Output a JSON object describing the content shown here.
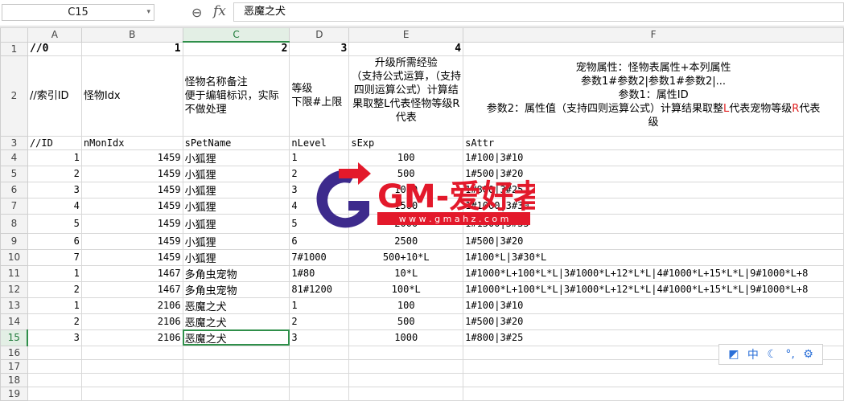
{
  "formula_bar": {
    "name_box": "C15",
    "fx_label": "fx",
    "value": "恶魔之犬"
  },
  "columns": [
    "A",
    "B",
    "C",
    "D",
    "E",
    "F"
  ],
  "row_numbers": [
    "1",
    "2",
    "3",
    "4",
    "5",
    "6",
    "7",
    "8",
    "9",
    "10",
    "11",
    "12",
    "13",
    "14",
    "15",
    "16",
    "17",
    "18",
    "19"
  ],
  "row1": [
    "//0",
    "1",
    "2",
    "3",
    "4",
    ""
  ],
  "row2": {
    "a": "//索引ID",
    "b": "怪物Idx",
    "c": "怪物名称备注\n便于编辑标识，实际不做处理",
    "d": "等级\n下限#上限",
    "e": "升级所需经验\n（支持公式运算，（支持四则运算公式）计算结果取整L代表怪物等级R代表",
    "f_line1": "宠物属性：怪物表属性+本列属性",
    "f_line2": "参数1#参数2|参数1#参数2|...",
    "f_line3": "参数1：属性ID",
    "f_line4a": "参数2：属性值（支持四则运算公式）计算结果取整",
    "f_red1": "L",
    "f_line4b": "代表宠物等级",
    "f_red2": "R",
    "f_line4c": "代表",
    "f_line5": "级"
  },
  "row3": [
    "//ID",
    "nMonIdx",
    "sPetName",
    "nLevel",
    "sExp",
    "sAttr"
  ],
  "data_rows": [
    [
      "1",
      "1459",
      "小狐狸",
      "1",
      "100",
      "1#100|3#10"
    ],
    [
      "2",
      "1459",
      "小狐狸",
      "2",
      "500",
      "1#500|3#20"
    ],
    [
      "3",
      "1459",
      "小狐狸",
      "3",
      "1000",
      "1#800|3#25"
    ],
    [
      "4",
      "1459",
      "小狐狸",
      "4",
      "1500",
      "1#1000|3#30"
    ],
    [
      "5",
      "1459",
      "小狐狸",
      "5",
      "2000",
      "1#1500|3#35"
    ],
    [
      "6",
      "1459",
      "小狐狸",
      "6",
      "2500",
      "1#500|3#20"
    ],
    [
      "7",
      "1459",
      "小狐狸",
      "7#1000",
      "500+10*L",
      "1#100*L|3#30*L"
    ],
    [
      "1",
      "1467",
      "多角虫宠物",
      "1#80",
      "10*L",
      "1#1000*L+100*L*L|3#1000*L+12*L*L|4#1000*L+15*L*L|9#1000*L+8"
    ],
    [
      "2",
      "1467",
      "多角虫宠物",
      "81#1200",
      "100*L",
      "1#1000*L+100*L*L|3#1000*L+12*L*L|4#1000*L+15*L*L|9#1000*L+8"
    ],
    [
      "1",
      "2106",
      "恶魔之犬",
      "1",
      "100",
      "1#100|3#10"
    ],
    [
      "2",
      "2106",
      "恶魔之犬",
      "2",
      "500",
      "1#500|3#20"
    ],
    [
      "3",
      "2106",
      "恶魔之犬",
      "3",
      "1000",
      "1#800|3#25"
    ]
  ],
  "watermark": {
    "logo_letter": "G",
    "text": "GM-爱好者",
    "url": "w w w . g m a h z . c o m"
  },
  "ime_bar": {
    "lang": "中"
  },
  "colors": {
    "accent_green": "#2f8f4a",
    "watermark_red": "#e3192b",
    "watermark_purple": "#3d2a8c"
  }
}
